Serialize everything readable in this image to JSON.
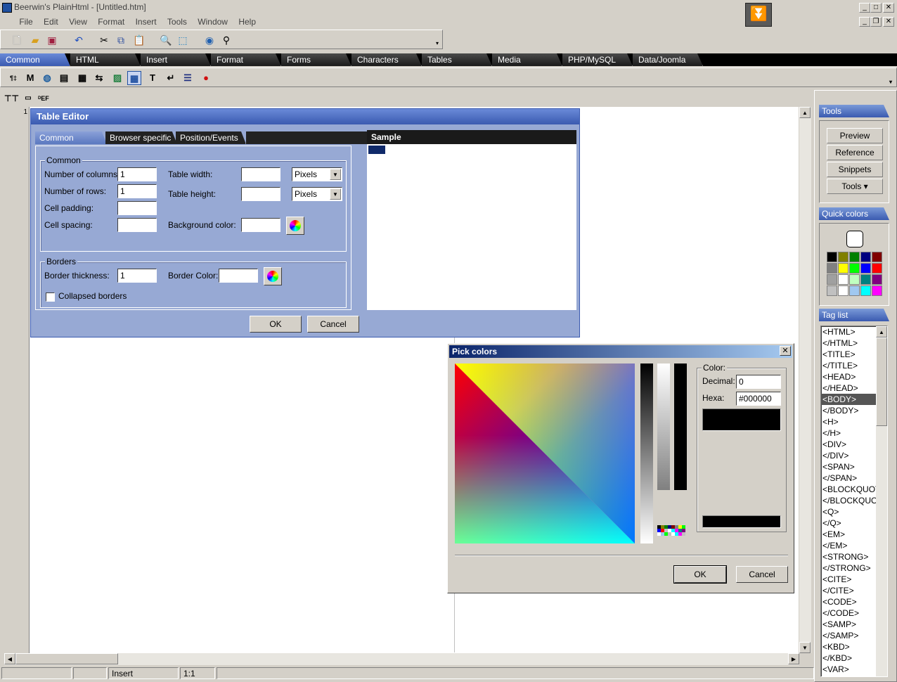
{
  "window": {
    "title": "Beerwin's PlainHtml - [Untitled.htm]"
  },
  "menu": [
    "File",
    "Edit",
    "View",
    "Format",
    "Insert",
    "Tools",
    "Window",
    "Help"
  ],
  "category_tabs": [
    "Common",
    "HTML",
    "Insert",
    "Format",
    "Forms",
    "Characters",
    "Tables",
    "Media",
    "PHP/MySQL",
    "Data/Joomla"
  ],
  "editor": {
    "line_number": "1"
  },
  "status": {
    "mode": "Insert",
    "position": "1:1"
  },
  "right_panel": {
    "tools_header": "Tools",
    "buttons": [
      "Preview",
      "Reference",
      "Snippets",
      "Tools ▾"
    ],
    "quick_colors_header": "Quick colors",
    "quick_colors": [
      [
        "#000000",
        "#808000",
        "#008000",
        "#000080",
        "#800000"
      ],
      [
        "#808080",
        "#ffff00",
        "#00ff00",
        "#0000ff",
        "#ff0000"
      ],
      [
        "#a0a0a0",
        "#ffffff",
        "#c0ffc0",
        "#008080",
        "#800080"
      ],
      [
        "#c0c0c0",
        "#ffffff",
        "#a0c8f0",
        "#00ffff",
        "#ff00ff"
      ]
    ],
    "tag_list_header": "Tag list",
    "tags": [
      "<HTML>",
      "</HTML>",
      "<TITLE>",
      "</TITLE>",
      "<HEAD>",
      "</HEAD>",
      "<BODY>",
      "</BODY>",
      "<H>",
      "</H>",
      "<DIV>",
      "</DIV>",
      "<SPAN>",
      "</SPAN>",
      "<BLOCKQUOTE",
      "</BLOCKQUOT",
      "<Q>",
      "</Q>",
      "<EM>",
      "</EM>",
      "<STRONG>",
      "</STRONG>",
      "<CITE>",
      "</CITE>",
      "<CODE>",
      "</CODE>",
      "<SAMP>",
      "</SAMP>",
      "<KBD>",
      "</KBD>",
      "<VAR>"
    ],
    "selected_tag_index": 6
  },
  "table_editor": {
    "title": "Table Editor",
    "tabs": [
      "Common",
      "Browser specific",
      "Position/Events"
    ],
    "sample_label": "Sample",
    "common_group": "Common",
    "labels": {
      "columns": "Number of columns:",
      "rows": "Number of rows:",
      "padding": "Cell padding:",
      "spacing": "Cell spacing:",
      "width": "Table width:",
      "height": "Table height:",
      "bgcolor": "Background color:"
    },
    "values": {
      "columns": "1",
      "rows": "1",
      "padding": "",
      "spacing": "",
      "width": "",
      "height": "",
      "bgcolor": "",
      "width_unit": "Pixels",
      "height_unit": "Pixels"
    },
    "borders_group": "Borders",
    "border_labels": {
      "thickness": "Border thickness:",
      "color": "Border Color:",
      "collapsed": "Collapsed borders"
    },
    "border_values": {
      "thickness": "1",
      "color": "",
      "collapsed": false
    },
    "ok": "OK",
    "cancel": "Cancel"
  },
  "pick_colors": {
    "title": "Pick colors",
    "close": "✕",
    "color_group": "Color:",
    "decimal_label": "Decimal:",
    "decimal_value": "0",
    "hexa_label": "Hexa:",
    "hexa_value": "#000000",
    "selected_color": "#000000",
    "ok": "OK",
    "cancel": "Cancel"
  }
}
